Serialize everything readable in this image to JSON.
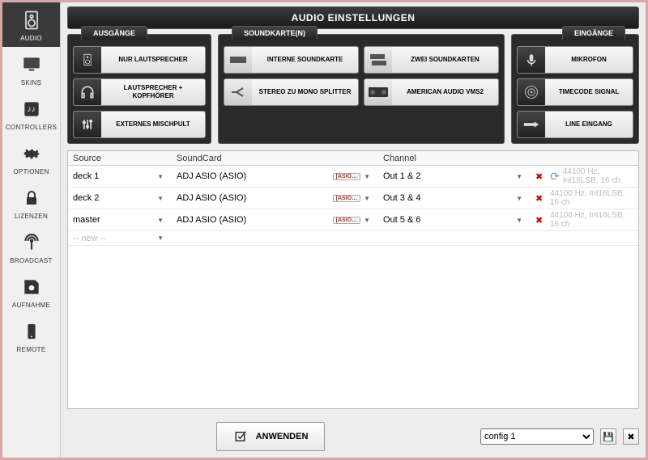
{
  "header": {
    "title": "AUDIO EINSTELLUNGEN"
  },
  "sidebar": {
    "items": [
      {
        "label": "AUDIO",
        "icon": "speaker"
      },
      {
        "label": "SKINS",
        "icon": "monitor"
      },
      {
        "label": "CONTROLLERS",
        "icon": "sliders"
      },
      {
        "label": "OPTIONEN",
        "icon": "gear"
      },
      {
        "label": "LIZENZEN",
        "icon": "lock"
      },
      {
        "label": "BROADCAST",
        "icon": "broadcast"
      },
      {
        "label": "AUFNAHME",
        "icon": "record"
      },
      {
        "label": "REMOTE",
        "icon": "remote"
      }
    ]
  },
  "panels": {
    "outputs": {
      "title": "AUSGÄNGE",
      "buttons": [
        {
          "label": "NUR LAUTSPRECHER"
        },
        {
          "label": "LAUTSPRECHER + KOPFHÖRER"
        },
        {
          "label": "EXTERNES MISCHPULT"
        }
      ]
    },
    "cards": {
      "title": "SOUNDKARTE(N)",
      "buttons": [
        {
          "label": "INTERNE SOUNDKARTE"
        },
        {
          "label": "ZWEI SOUNDKARTEN"
        },
        {
          "label": "STEREO ZU MONO SPLITTER"
        },
        {
          "label": "AMERICAN AUDIO VMS2"
        }
      ]
    },
    "inputs": {
      "title": "EINGÄNGE",
      "buttons": [
        {
          "label": "MIKROFON"
        },
        {
          "label": "TIMECODE SIGNAL"
        },
        {
          "label": "LINE EINGANG"
        }
      ]
    }
  },
  "table": {
    "headers": {
      "source": "Source",
      "card": "SoundCard",
      "channel": "Channel"
    },
    "rows": [
      {
        "source": "deck 1",
        "card": "ADJ ASIO (ASIO)",
        "channel": "Out 1 & 2",
        "info": "44100 Hz, Int16LSB, 16 ch",
        "refresh": true
      },
      {
        "source": "deck 2",
        "card": "ADJ ASIO (ASIO)",
        "channel": "Out 3 & 4",
        "info": "44100 Hz, Int16LSB, 16 ch"
      },
      {
        "source": "master",
        "card": "ADJ ASIO (ASIO)",
        "channel": "Out 5 & 6",
        "info": "44100 Hz, Int16LSB, 16 ch"
      }
    ],
    "new_label": "-- new --",
    "asio_label": "[ASIO…"
  },
  "footer": {
    "apply": "ANWENDEN",
    "config": "config 1"
  }
}
